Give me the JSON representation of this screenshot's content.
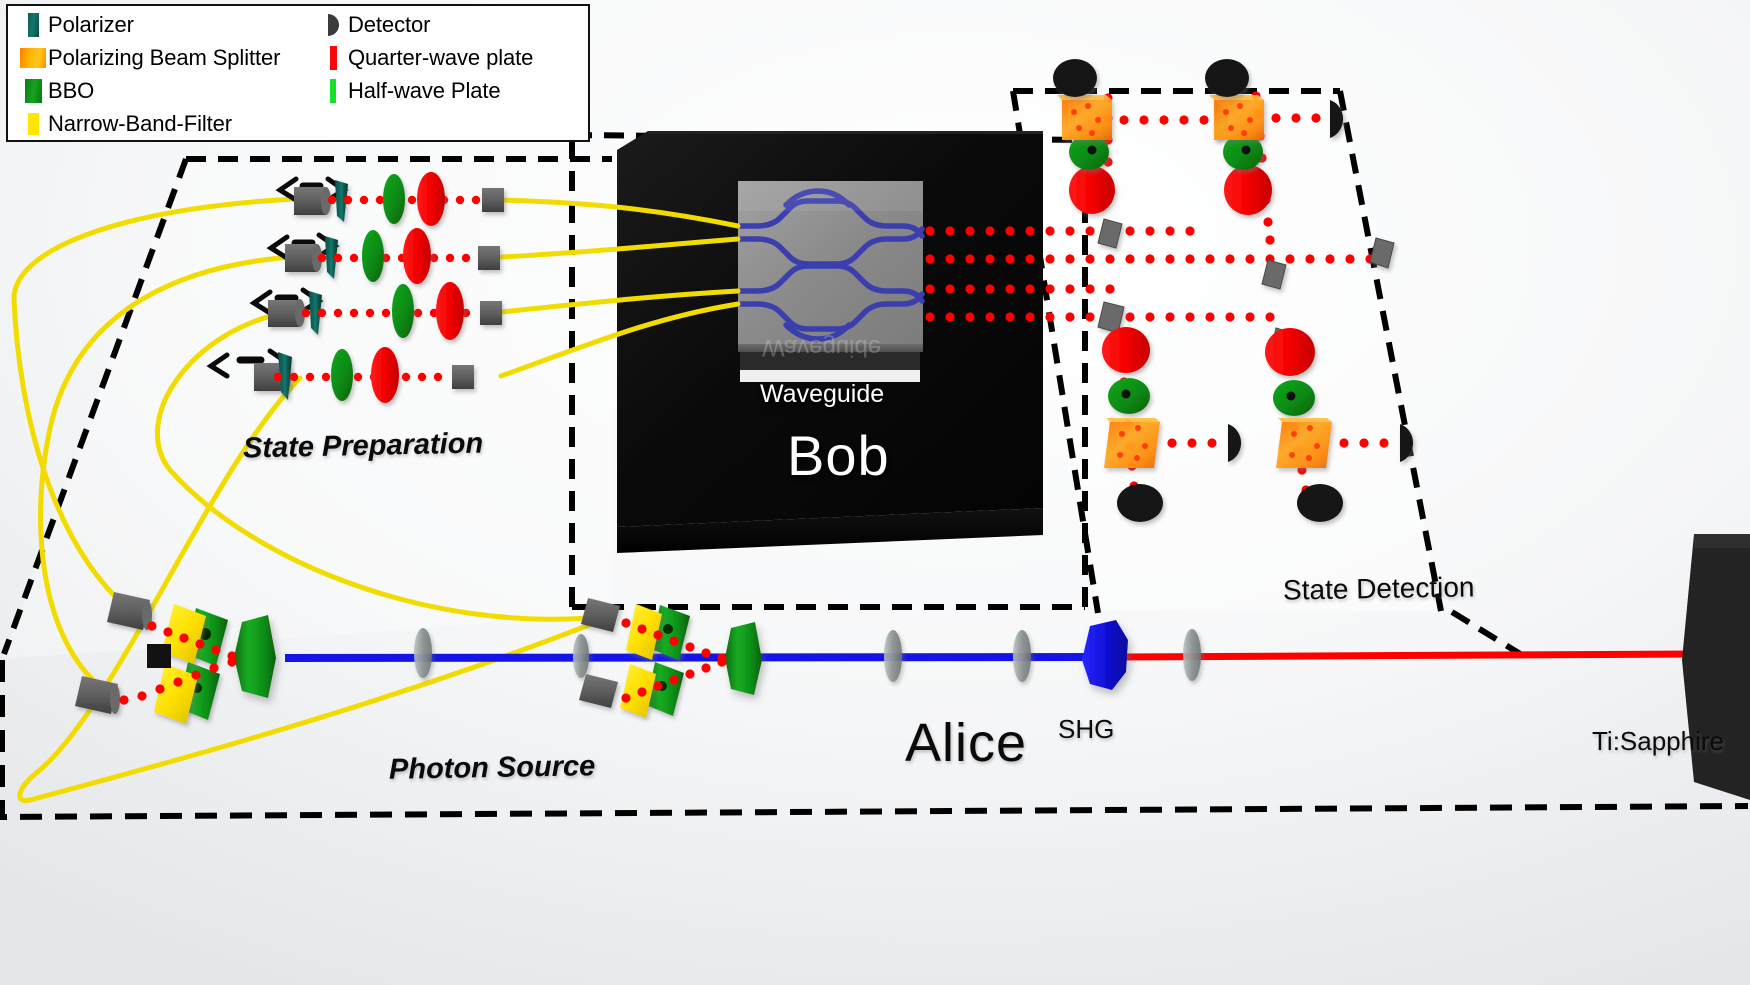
{
  "legend": {
    "items_left": [
      {
        "label": "Polarizer",
        "icon": "polarizer-swatch",
        "color": "#0d5b54"
      },
      {
        "label": "Polarizing Beam Splitter",
        "icon": "pbs-swatch",
        "color": "#ffae00"
      },
      {
        "label": "BBO",
        "icon": "bbo-swatch",
        "color": "#12a01c"
      },
      {
        "label": "Narrow-Band-Filter",
        "icon": "narrow-band-filter-swatch",
        "color": "#ffe500"
      }
    ],
    "items_right": [
      {
        "label": "Detector",
        "icon": "detector-swatch",
        "color": "#3b3b3b"
      },
      {
        "label": "Quarter-wave plate",
        "icon": "quarter-wave-plate-swatch",
        "color": "#f50a0a"
      },
      {
        "label": "Half-wave Plate",
        "icon": "half-wave-plate-swatch",
        "color": "#17e02a"
      }
    ]
  },
  "labels": {
    "state_preparation": "State Preparation",
    "photon_source": "Photon Source",
    "state_detection": "State Detection",
    "alice": "Alice",
    "bob": "Bob",
    "shg": "SHG",
    "ti_sapphire": "Ti:Sapphire",
    "waveguide": "Waveguide",
    "waveguide_reflection": "Waveguide"
  },
  "colors": {
    "polarizer": "#0d5b54",
    "pbs": "#ff9a00",
    "bbo": "#0f8f18",
    "narrow_band_filter": "#ffe500",
    "detector": "#2b2b2b",
    "quarter_wave_plate": "#f50a0a",
    "half_wave_plate": "#17e02a",
    "fiber": "#f2dc00",
    "photon_path": "#ff0000",
    "pump_uv": "#1414e6",
    "pump_ir": "#ff0000",
    "waveguide_channel": "#3b3fae",
    "chip_surface": "#8d8d8d",
    "table": "#0b0b0b",
    "boundary": "#000000",
    "background": "#f2f3f4"
  },
  "scene": {
    "state_preparation_channels": 4,
    "state_preparation_sequence": [
      "fiber-coupler",
      "polarizer",
      "half-wave-plate",
      "quarter-wave-plate",
      "fiber-coupler"
    ],
    "detection_sequence": [
      "mirror",
      "quarter-wave-plate",
      "half-wave-plate",
      "polarizing-beam-splitter",
      "detector"
    ],
    "detection_columns": 2,
    "detection_rows": 2,
    "waveguide_inputs": 4,
    "waveguide_outputs": 4,
    "photon_source_crystals": 2,
    "laser_beam_segments": [
      "ir-red-from-laser",
      "uv-blue-after-shg"
    ]
  }
}
